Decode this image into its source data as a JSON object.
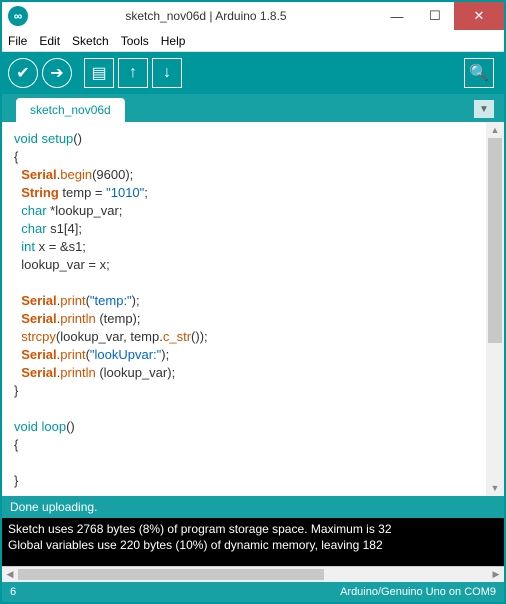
{
  "window": {
    "title": "sketch_nov06d | Arduino 1.8.5"
  },
  "menu": {
    "file": "File",
    "edit": "Edit",
    "sketch": "Sketch",
    "tools": "Tools",
    "help": "Help"
  },
  "tab": {
    "name": "sketch_nov06d"
  },
  "code": {
    "l1a": "void",
    "l1b": " ",
    "l1c": "setup",
    "l1d": "()",
    "l2": "{",
    "l3a": "  ",
    "l3b": "Serial",
    "l3c": ".",
    "l3d": "begin",
    "l3e": "(9600);",
    "l4a": "  ",
    "l4b": "String",
    "l4c": " temp = ",
    "l4d": "\"1010\"",
    "l4e": ";",
    "l5a": "  ",
    "l5b": "char",
    "l5c": " *lookup_var;",
    "l6a": "  ",
    "l6b": "char",
    "l6c": " s1[4];",
    "l7a": "  ",
    "l7b": "int",
    "l7c": " x = &s1;",
    "l8": "  lookup_var = x;",
    "l9": "",
    "l10a": "  ",
    "l10b": "Serial",
    "l10c": ".",
    "l10d": "print",
    "l10e": "(",
    "l10f": "\"temp:\"",
    "l10g": ");",
    "l11a": "  ",
    "l11b": "Serial",
    "l11c": ".",
    "l11d": "println",
    "l11e": " (temp);",
    "l12a": "  ",
    "l12b": "strcpy",
    "l12c": "(lookup_var, temp.",
    "l12d": "c_str",
    "l12e": "());",
    "l13a": "  ",
    "l13b": "Serial",
    "l13c": ".",
    "l13d": "print",
    "l13e": "(",
    "l13f": "\"lookUpvar:\"",
    "l13g": ");",
    "l14a": "  ",
    "l14b": "Serial",
    "l14c": ".",
    "l14d": "println",
    "l14e": " (lookup_var);",
    "l15": "}",
    "l16": "",
    "l17a": "void",
    "l17b": " ",
    "l17c": "loop",
    "l17d": "()",
    "l18": "{",
    "l19": "",
    "l20": "}"
  },
  "status": {
    "text": "Done uploading."
  },
  "console": {
    "l1": "Sketch uses 2768 bytes (8%) of program storage space. Maximum is 32",
    "l2": "Global variables use 220 bytes (10%) of dynamic memory, leaving 182"
  },
  "footer": {
    "line": "6",
    "board": "Arduino/Genuino Uno on COM9"
  }
}
